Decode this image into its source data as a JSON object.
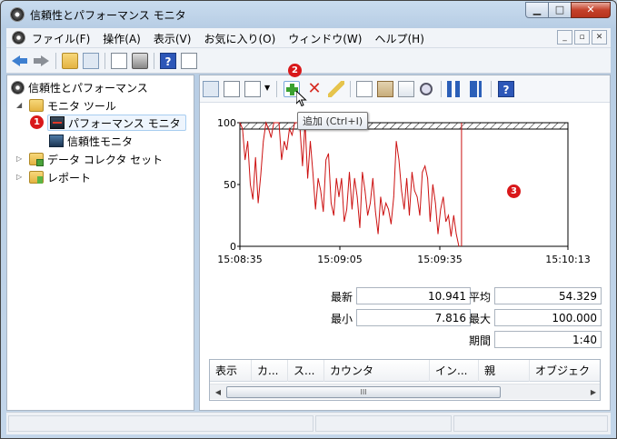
{
  "window": {
    "title": "信頼性とパフォーマンス モニタ"
  },
  "menu": {
    "items": [
      "ファイル(F)",
      "操作(A)",
      "表示(V)",
      "お気に入り(O)",
      "ウィンドウ(W)",
      "ヘルプ(H)"
    ]
  },
  "tree": {
    "root": "信頼性とパフォーマンス",
    "monitor_tools": "モニタ ツール",
    "perf_monitor": "パフォーマンス モニタ",
    "reliability_monitor": "信頼性モニタ",
    "data_collector_sets": "データ コレクタ セット",
    "reports": "レポート"
  },
  "badges": {
    "one": "1",
    "two": "2",
    "three": "3"
  },
  "tooltip": {
    "text": "追加 (Ctrl+I)"
  },
  "chart_data": {
    "type": "line",
    "y_ticks": [
      "100",
      "50",
      "0"
    ],
    "x_ticks": [
      "15:08:35",
      "15:09:05",
      "15:09:35",
      "15:10:13"
    ],
    "ylim": [
      0,
      100
    ],
    "color": "#cc1111",
    "values": [
      100,
      95,
      70,
      85,
      50,
      38,
      72,
      35,
      58,
      85,
      100,
      95,
      88,
      100,
      100,
      100,
      70,
      85,
      78,
      95,
      90,
      100,
      100,
      97,
      65,
      100,
      55,
      85,
      60,
      30,
      55,
      45,
      28,
      70,
      75,
      35,
      25,
      55,
      40,
      55,
      20,
      30,
      60,
      30,
      55,
      40,
      15,
      60,
      45,
      25,
      35,
      55,
      28,
      10,
      40,
      25,
      35,
      30,
      18,
      40,
      85,
      70,
      45,
      30,
      55,
      25,
      60,
      45,
      40,
      25,
      60,
      65,
      55,
      20,
      50,
      35,
      10,
      30,
      40,
      20,
      25,
      8,
      25,
      10,
      0
    ],
    "marker_line_at": 85
  },
  "stats": {
    "last_label": "最新",
    "last_value": "10.941",
    "avg_label": "平均",
    "avg_value": "54.329",
    "min_label": "最小",
    "min_value": "7.816",
    "max_label": "最大",
    "max_value": "100.000",
    "duration_label": "期間",
    "duration_value": "1:40"
  },
  "grid": {
    "columns": [
      "表示",
      "カ...",
      "ス...",
      "カウンタ",
      "イン...",
      "親",
      "オブジェク"
    ]
  },
  "scrollbar": {
    "thumb_glyph": "III"
  }
}
